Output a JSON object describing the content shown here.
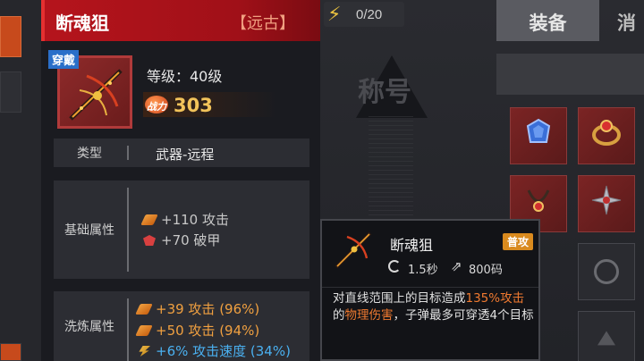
{
  "energy": {
    "count": "0/20"
  },
  "title_banner": "称号",
  "tabs": [
    {
      "label": "装备"
    },
    {
      "label": "消"
    }
  ],
  "item": {
    "name": "断魂狙",
    "tier": "【远古】",
    "wear_badge": "穿戴",
    "level": "等级：40级",
    "power_label": "战力",
    "power_value": "303"
  },
  "rows": {
    "type_key": "类型",
    "type_value": "武器-远程",
    "base_key": "基础属性",
    "base_stats": [
      {
        "text": "+110 攻击",
        "icon": "attack-icon"
      },
      {
        "text": "+70 破甲",
        "icon": "armor-break-icon"
      }
    ],
    "wash_key": "洗炼属性",
    "wash_stats": [
      {
        "text": "+39 攻击 (96%)",
        "icon": "attack-icon",
        "color": "#f0a040"
      },
      {
        "text": "+50 攻击 (94%)",
        "icon": "attack-icon",
        "color": "#f0a040"
      },
      {
        "text": "+6% 攻击速度 (34%)",
        "icon": "attack-speed-icon",
        "color": "#4ab0f0"
      }
    ]
  },
  "tooltip": {
    "name": "断魂狙",
    "tag": "普攻",
    "cooldown": "1.5秒",
    "range": "800码",
    "desc_parts": [
      {
        "text": "对直线范围上的目标造成",
        "hl": false
      },
      {
        "text": "135%攻击",
        "hl": true
      },
      {
        "text": "的",
        "hl": false
      },
      {
        "text": "物理伤害",
        "hl": true
      },
      {
        "text": "，子弹最多可穿透4个目标",
        "hl": false
      }
    ]
  },
  "colors": {
    "header_red": "#b5141c",
    "tier_color": "#f0a080",
    "power_gold": "#f2c35a",
    "highlight_orange": "#f07a30"
  }
}
